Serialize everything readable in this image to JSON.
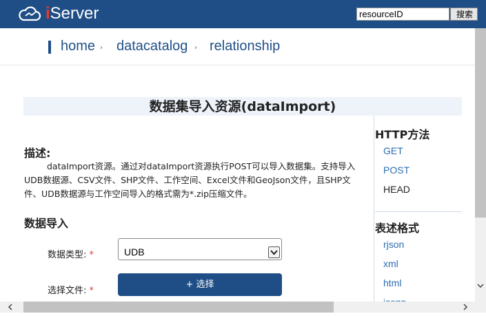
{
  "header": {
    "logo_i": "i",
    "logo_rest": "Server",
    "search_value": "resourceID",
    "search_button": "搜索"
  },
  "breadcrumb": {
    "items": [
      "home",
      "datacatalog",
      "relationship"
    ],
    "separator": "›"
  },
  "main": {
    "title": "数据集导入资源(dataImport)",
    "description_heading": "描述:",
    "description_text": "dataImport资源。通过对dataImport资源执行POST可以导入数据集。支持导入UDB数据源、CSV文件、SHP文件、工作空间、Excel文件和GeoJson文件，且SHP文件、UDB数据源与工作空间导入的格式需为*.zip压缩文件。",
    "import_heading": "数据导入",
    "form": {
      "data_type_label": "数据类型:",
      "data_type_value": "UDB",
      "file_label": "选择文件:",
      "required_mark": "*",
      "upload_button": "+ 选择"
    }
  },
  "sidebar": {
    "http_methods_title": "HTTP方法",
    "http_methods": [
      "GET",
      "POST",
      "HEAD"
    ],
    "formats_title": "表述格式",
    "formats": [
      "rjson",
      "xml",
      "html",
      "jsonp"
    ]
  },
  "colors": {
    "header_bg": "#1f4e86",
    "link": "#2b6cb0",
    "required": "#e53935",
    "title_band": "#eef3fa"
  },
  "icons": {
    "logo": "cloud-icon",
    "dropdown": "chevron-down-icon",
    "scroll_up": "caret-up-icon",
    "scroll_down": "chevron-down-icon",
    "scroll_left": "chevron-left-icon",
    "scroll_right": "chevron-right-icon"
  }
}
